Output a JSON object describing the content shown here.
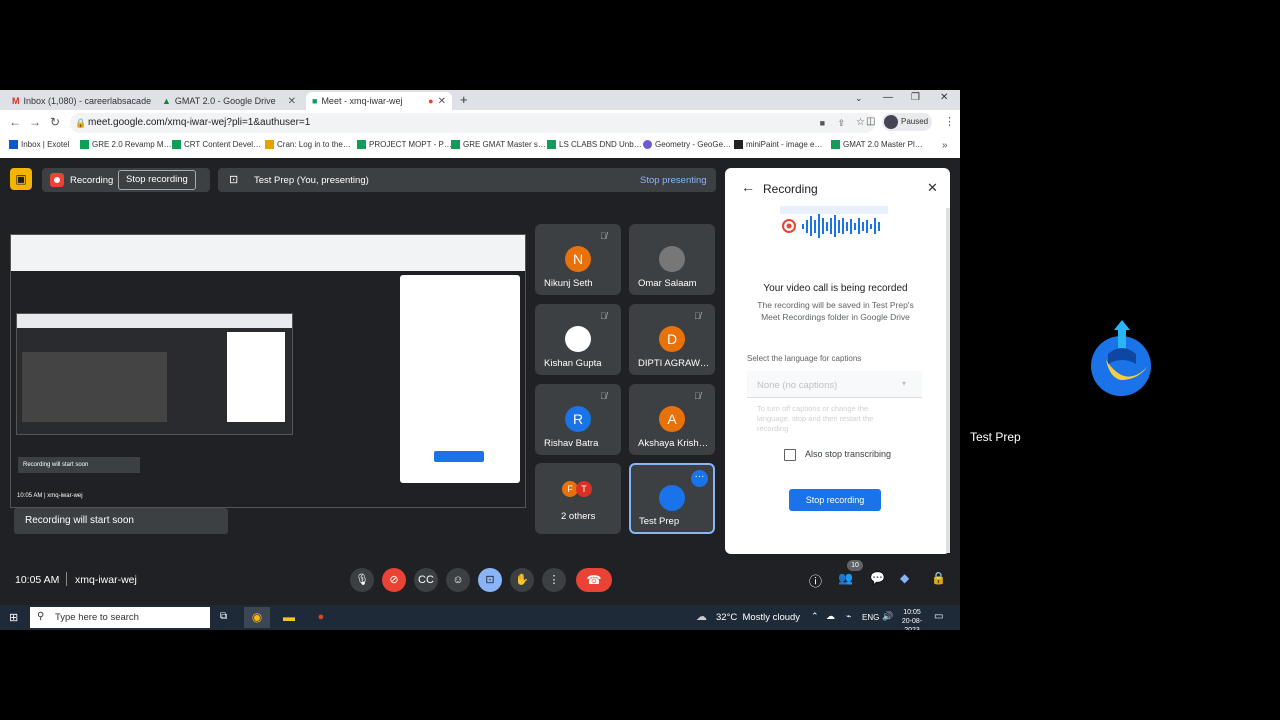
{
  "browser": {
    "tabs": [
      {
        "label": "Inbox (1,080) - careerlabsacade…",
        "icon": "gmail-icon"
      },
      {
        "label": "GMAT 2.0 - Google Drive",
        "icon": "drive-icon"
      },
      {
        "label": "Meet - xmq-iwar-wej",
        "icon": "meet-icon",
        "active": true
      }
    ],
    "new_tab": "+",
    "url": "meet.google.com/xmq-iwar-wej?pli=1&authuser=1",
    "profile_status": "Paused",
    "bookmarks": [
      "Inbox | Exotel",
      "GRE 2.0 Revamp M…",
      "CRT Content Devel…",
      "Cran: Log in to the…",
      "PROJECT MOPT - P…",
      "GRE GMAT Master s…",
      "LS CLABS DND Unb…",
      "Geometry - GeoGe…",
      "miniPaint - image e…",
      "GMAT 2.0 Master Pl…"
    ]
  },
  "meet": {
    "recording_label": "Recording",
    "stop_recording_btn": "Stop recording",
    "presenting_label": "Test Prep (You, presenting)",
    "stop_presenting": "Stop presenting",
    "participants": [
      {
        "name": "Nikunj Seth",
        "initial": "N",
        "color": "#e8710a"
      },
      {
        "name": "Omar Salaam",
        "initial": "",
        "color": "#777777"
      },
      {
        "name": "Kishan Gupta",
        "initial": "",
        "color": "#ffffff"
      },
      {
        "name": "DIPTI AGRAW…",
        "initial": "D",
        "color": "#e8710a"
      },
      {
        "name": "Rishav Batra",
        "initial": "R",
        "color": "#1a73e8"
      },
      {
        "name": "Akshaya Krish…",
        "initial": "A",
        "color": "#e8710a"
      },
      {
        "name": "2 others",
        "initial": "F T",
        "color": "#e8710a"
      },
      {
        "name": "Test Prep",
        "initial": "",
        "color": "#1a73e8"
      }
    ],
    "toast": "Recording will start soon",
    "time": "10:05 AM",
    "meeting_code": "xmq-iwar-wej",
    "participant_count": "10"
  },
  "panel": {
    "title": "Recording",
    "heading": "Your video call is being recorded",
    "subtext": "The recording will be saved in Test Prep's Meet Recordings folder in Google Drive",
    "captions_label": "Select the language for captions",
    "captions_value": "None (no captions)",
    "captions_help": "To turn off captions or change the language, stop and then restart the recording",
    "checkbox_label": "Also stop transcribing",
    "stop_button": "Stop recording"
  },
  "taskbar": {
    "search_placeholder": "Type here to search",
    "weather": "32°C  Mostly cloudy",
    "lang": "ENG",
    "clock_time": "10:05",
    "clock_date": "20-08-2023"
  },
  "side": {
    "name": "Test Prep"
  },
  "colors": {
    "accent": "#1a73e8",
    "hangup": "#ea4335",
    "record": "#ea4335"
  }
}
